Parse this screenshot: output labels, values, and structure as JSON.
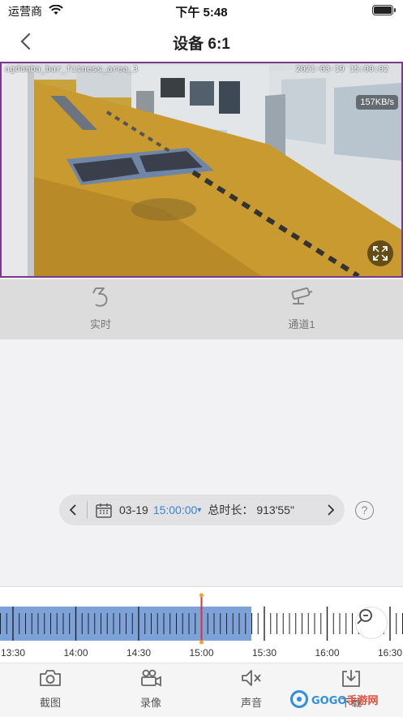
{
  "status_bar": {
    "carrier": "运营商",
    "time": "下午 5:48"
  },
  "nav": {
    "title": "设备 6:1"
  },
  "video": {
    "osd_name": "agdamba_bar_fitness_area_3",
    "osd_time": "2021-03-19 15:00:02",
    "speed": "157KB/s"
  },
  "controls": {
    "realtime_label": "实时",
    "channel_label": "通道1"
  },
  "playback": {
    "date": "03-19",
    "time": "15:00:00",
    "caret": "▾",
    "duration_label": "总时长：",
    "duration_value": "913'55\"",
    "help": "?"
  },
  "timeline": {
    "labels": [
      "13:30",
      "14:00",
      "14:30",
      "15:00",
      "15:30",
      "16:00",
      "16:30"
    ],
    "recorded_until": "15:30",
    "cursor_time": "15:00",
    "colors": {
      "recorded": "#7da2d8",
      "cursor": "#e03030",
      "cursor_dot": "#f2a51c"
    }
  },
  "toolbar": {
    "snapshot_label": "截图",
    "record_label": "录像",
    "sound_label": "声音",
    "download_label": "下载"
  },
  "watermark": {
    "brand": "GOGO",
    "suffix": "手游网"
  }
}
